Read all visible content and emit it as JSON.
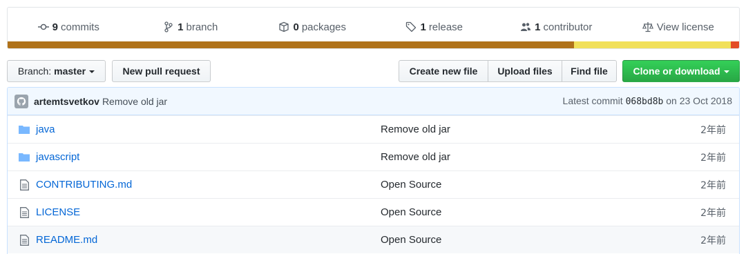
{
  "summary": {
    "items": [
      {
        "icon": "commit-icon",
        "num": "9",
        "label": "commits"
      },
      {
        "icon": "branch-icon",
        "num": "1",
        "label": "branch"
      },
      {
        "icon": "package-icon",
        "num": "0",
        "label": "packages"
      },
      {
        "icon": "tag-icon",
        "num": "1",
        "label": "release"
      },
      {
        "icon": "people-icon",
        "num": "1",
        "label": "contributor"
      },
      {
        "icon": "law-icon",
        "num": "",
        "label": "View license"
      }
    ],
    "languages": [
      {
        "color": "#b07219",
        "share": 0.774
      },
      {
        "color": "#f1e05a",
        "share": 0.215
      },
      {
        "color": "#e34c26",
        "share": 0.011
      }
    ]
  },
  "toolbar": {
    "branch_prefix": "Branch:",
    "branch_name": "master",
    "new_pr": "New pull request",
    "create_file": "Create new file",
    "upload_files": "Upload files",
    "find_file": "Find file",
    "clone": "Clone or download"
  },
  "commit": {
    "author": "artemtsvetkov",
    "message": "Remove old jar",
    "latest_label": "Latest commit",
    "sha": "068bd8b",
    "date": "on 23 Oct 2018"
  },
  "files": [
    {
      "type": "dir",
      "name": "java",
      "message": "Remove old jar",
      "age": "2年前"
    },
    {
      "type": "dir",
      "name": "javascript",
      "message": "Remove old jar",
      "age": "2年前"
    },
    {
      "type": "file",
      "name": "CONTRIBUTING.md",
      "message": "Open Source",
      "age": "2年前"
    },
    {
      "type": "file",
      "name": "LICENSE",
      "message": "Open Source",
      "age": "2年前"
    },
    {
      "type": "file",
      "name": "README.md",
      "message": "Open Source",
      "age": "2年前"
    }
  ]
}
